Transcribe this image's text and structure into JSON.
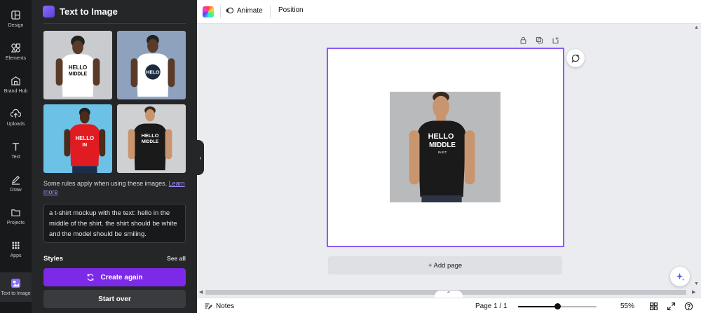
{
  "sidebar": {
    "items": [
      {
        "label": "Design",
        "icon": "layout-icon"
      },
      {
        "label": "Elements",
        "icon": "shapes-icon"
      },
      {
        "label": "Brand Hub",
        "icon": "brand-hub-icon"
      },
      {
        "label": "Uploads",
        "icon": "cloud-upload-icon"
      },
      {
        "label": "Text",
        "icon": "text-t-icon"
      },
      {
        "label": "Draw",
        "icon": "pen-icon"
      },
      {
        "label": "Projects",
        "icon": "folder-icon"
      },
      {
        "label": "Apps",
        "icon": "grid-icon"
      },
      {
        "label": "Text to Image",
        "icon": "text-to-image-app-icon"
      }
    ]
  },
  "panel": {
    "title": "Text to Image",
    "images": [
      {
        "shirt_text": "HELLO MIDDLE",
        "shirt_color": "#ffffff",
        "bg": "#c9cbce"
      },
      {
        "shirt_text": "HELO",
        "shirt_color": "#ffffff",
        "bg": "#8ea2bd"
      },
      {
        "shirt_text": "HELLO IN",
        "shirt_color": "#e11b22",
        "bg": "#6cc1e6"
      },
      {
        "shirt_text": "HELLO MIDDLE",
        "shirt_color": "#1a1a1a",
        "bg": "#cfd0d2"
      }
    ],
    "rules_text": "Some rules apply when using these images.",
    "learn_more": "Learn more",
    "prompt": "a t-shirt mockup with the text: hello in the middle of the shirt. the shirt should be white and the model should be smiling.",
    "styles_heading": "Styles",
    "see_all": "See all",
    "create_again": "Create again",
    "start_over": "Start over"
  },
  "toolbar": {
    "animate": "Animate",
    "position": "Position"
  },
  "canvas": {
    "add_page": "+ Add page",
    "shirt_text_line1": "HELLO",
    "shirt_text_line2": "MIDDLE",
    "shirt_text_line3": "IN ET"
  },
  "bottombar": {
    "notes": "Notes",
    "page_indicator": "Page 1 / 1",
    "zoom": "55%",
    "zoom_fraction": 0.5
  },
  "colors": {
    "accent": "#7d2ae8",
    "selection": "#8b5cf6",
    "panel_bg": "#252627",
    "rail_bg": "#18191b"
  }
}
